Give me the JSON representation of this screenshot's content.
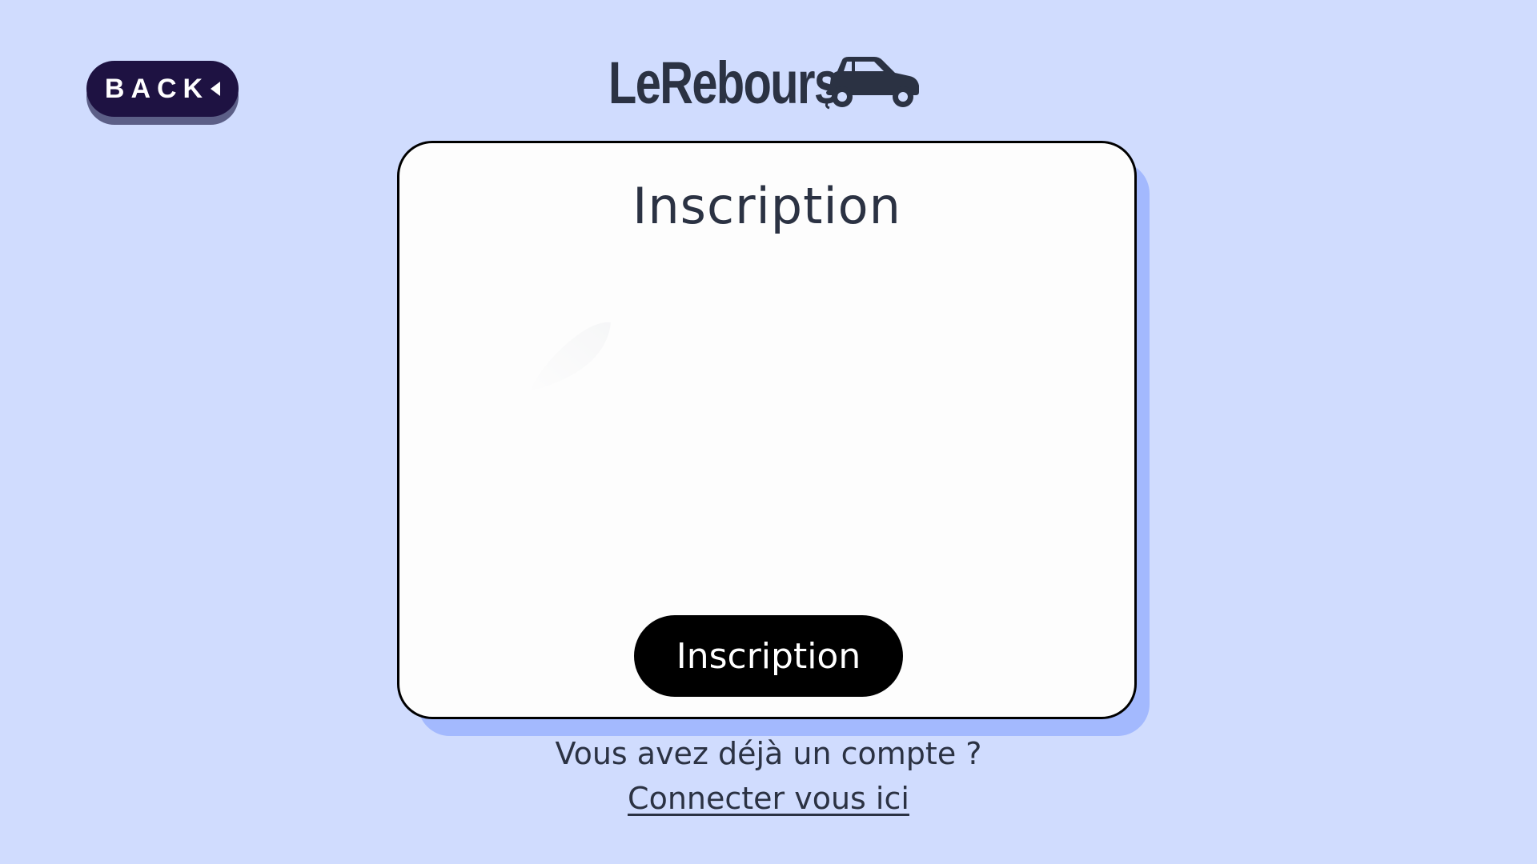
{
  "header": {
    "back_label": "BACK",
    "brand_name": "LeRebours",
    "logo_icon": "car-icon"
  },
  "signup_card": {
    "title": "Inscription",
    "submit_label": "Inscription",
    "decor_icon": "feather-icon"
  },
  "footer": {
    "prompt": "Vous avez déjà un compte ?",
    "login_link": "Connecter vous ici"
  },
  "colors": {
    "background": "#d0dcfe",
    "card_shadow": "#a3b9fe",
    "back_button": "#1e1242",
    "text_dark": "#2b3243",
    "submit_button": "#000000"
  }
}
